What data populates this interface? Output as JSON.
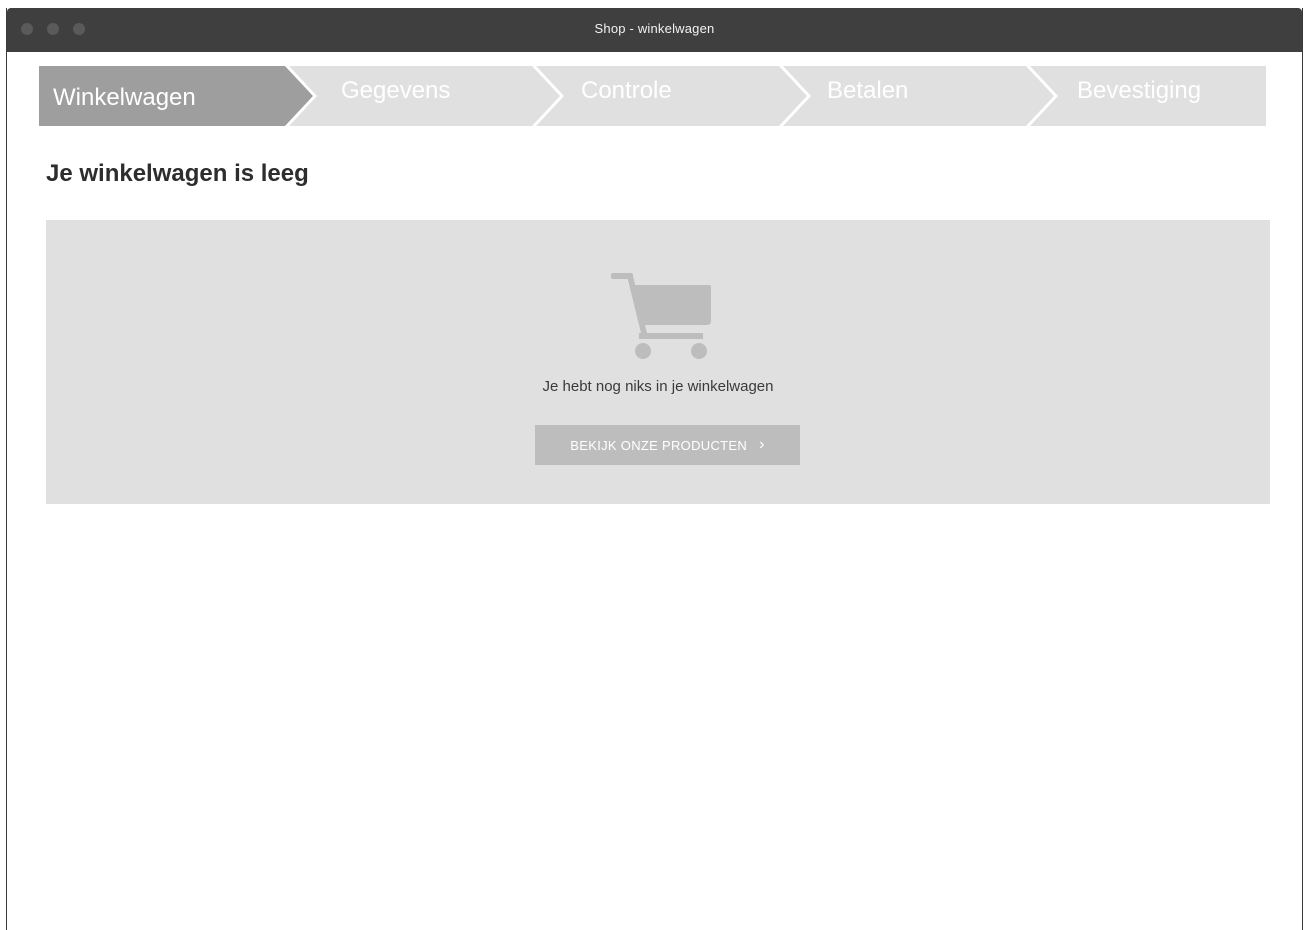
{
  "window": {
    "title": "Shop - winkelwagen"
  },
  "steps": [
    {
      "label": "Winkelwagen",
      "active": true
    },
    {
      "label": "Gegevens",
      "active": false
    },
    {
      "label": "Controle",
      "active": false
    },
    {
      "label": "Betalen",
      "active": false
    },
    {
      "label": "Bevestiging",
      "active": false
    }
  ],
  "main": {
    "heading": "Je winkelwagen is leeg",
    "empty_message": "Je hebt nog niks in je winkelwagen",
    "cta_label": "BEKIJK ONZE PRODUCTEN",
    "cta_icon": "chevron-right-icon",
    "empty_icon": "shopping-cart-icon"
  },
  "colors": {
    "titlebar": "#3f3f3f",
    "step_active": "#9e9e9e",
    "step_inactive": "#e0e0e0",
    "panel": "#e0e0e0",
    "button": "#bdbdbd",
    "cart_icon": "#bdbdbd"
  }
}
